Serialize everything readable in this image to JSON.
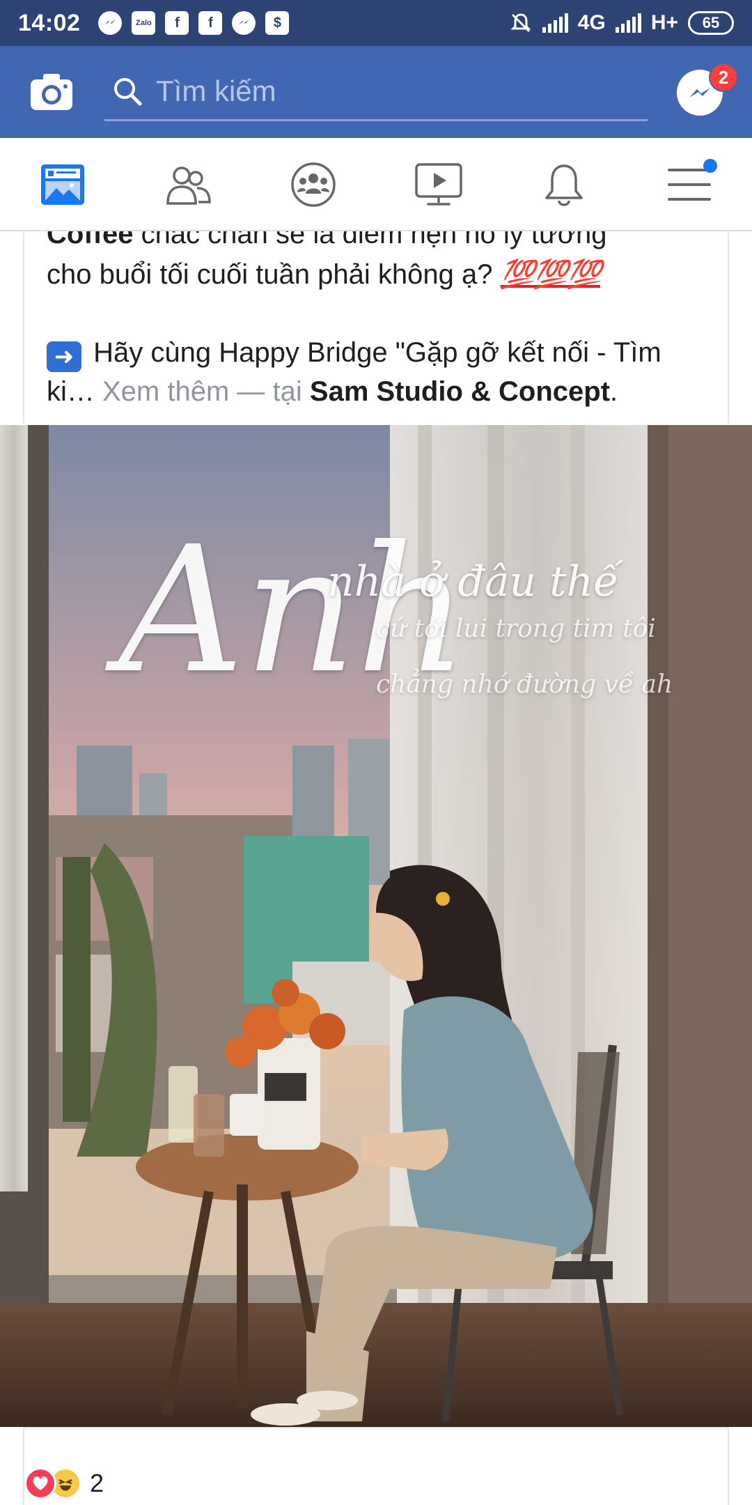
{
  "status_bar": {
    "time": "14:02",
    "notification_icons": [
      "messenger-icon",
      "zalo-icon",
      "facebook-icon",
      "facebook-icon",
      "messenger-icon",
      "shop-icon"
    ],
    "zalo_label": "Zalo",
    "network_1": "4G",
    "network_2": "H+",
    "battery": "65"
  },
  "header": {
    "search_placeholder": "Tìm kiếm",
    "messenger_badge": "2",
    "colors": {
      "bar": "#4267b2",
      "status_bar": "#2d4373",
      "badge": "#fa3e3e"
    }
  },
  "tabs": [
    "news-feed-icon",
    "friends-icon",
    "groups-icon",
    "watch-icon",
    "notifications-icon",
    "menu-icon"
  ],
  "post": {
    "line1_bold": "Coffee",
    "line1_rest": " chắc chắn sẽ là điểm hẹn hò lý tưởng",
    "line2": "cho buổi tối cuối tuần phải không ạ? ",
    "line2_emoji": "💯💯💯",
    "line3": " Hãy cùng Happy Bridge \"Gặp gỡ kết nối - Tìm",
    "line4_start": "ki… ",
    "see_more": "Xem thêm",
    "dash_at": " — tại ",
    "place": "Sam Studio & Concept",
    "period": "."
  },
  "photo": {
    "caption_big": "Anh",
    "caption_mid": "nhà ở đâu thế",
    "caption_line1": "cứ tới lui trong tim tôi",
    "caption_line2": "chẳng nhớ đường về ah"
  },
  "reactions": {
    "types": [
      "love-icon",
      "haha-icon"
    ],
    "count": "2"
  }
}
